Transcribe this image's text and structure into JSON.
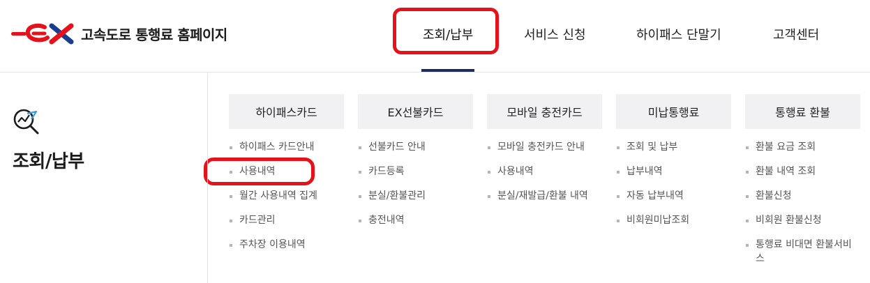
{
  "header": {
    "site_name": "고속도로 통행료 홈페이지",
    "nav": [
      {
        "label": "조회/납부"
      },
      {
        "label": "서비스 신청"
      },
      {
        "label": "하이패스 단말기"
      },
      {
        "label": "고객센터"
      }
    ],
    "active_nav": "조회/납부"
  },
  "section": {
    "title": "조회/납부",
    "icon": "search-chart-icon"
  },
  "columns": [
    {
      "title": "하이패스카드",
      "items": [
        "하이패스 카드안내",
        "사용내역",
        "월간 사용내역 집계",
        "카드관리",
        "주차장 이용내역"
      ]
    },
    {
      "title": "EX선불카드",
      "items": [
        "선불카드 안내",
        "카드등록",
        "분실/환불관리",
        "충전내역"
      ]
    },
    {
      "title": "모바일 충전카드",
      "items": [
        "모바일 충전카드 안내",
        "사용내역",
        "분실/재발급/환불 내역"
      ]
    },
    {
      "title": "미납통행료",
      "items": [
        "조회 및 납부",
        "납부내역",
        "자동 납부내역",
        "비회원미납조회"
      ]
    },
    {
      "title": "통행료 환불",
      "items": [
        "환불 요금 조회",
        "환불 내역 조회",
        "환불신청",
        "비회원 환불신청",
        "통행료 비대면 환불서비스"
      ]
    }
  ],
  "colors": {
    "brand_red": "#e5121b",
    "brand_blue": "#1c2a5c",
    "highlight": "#e5121b",
    "panel_bg": "#f1f1f3"
  }
}
